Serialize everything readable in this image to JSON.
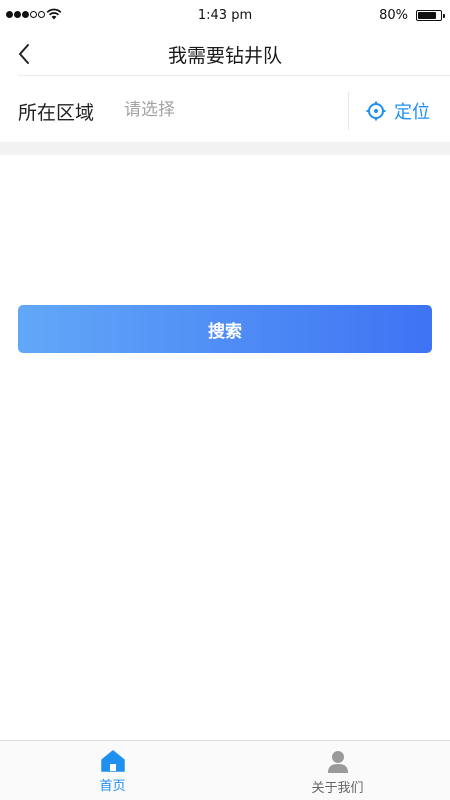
{
  "status_bar": {
    "time": "1:43 pm",
    "battery": "80%",
    "signal_bars_filled": 3,
    "signal_bars_total": 5
  },
  "nav": {
    "title": "我需要钻井队",
    "back_icon": "chevron-left-icon"
  },
  "region": {
    "label": "所在区域",
    "placeholder": "请选择",
    "value": "",
    "locate_label": "定位",
    "locate_icon": "crosshair-icon"
  },
  "search": {
    "label": "搜索"
  },
  "tabs": [
    {
      "label": "首页",
      "icon": "home-icon",
      "active": true
    },
    {
      "label": "关于我们",
      "icon": "person-icon",
      "active": false
    }
  ],
  "colors": {
    "accent": "#1f8ff0",
    "button_gradient_start": "#62a8f8",
    "button_gradient_end": "#3e73f3"
  }
}
